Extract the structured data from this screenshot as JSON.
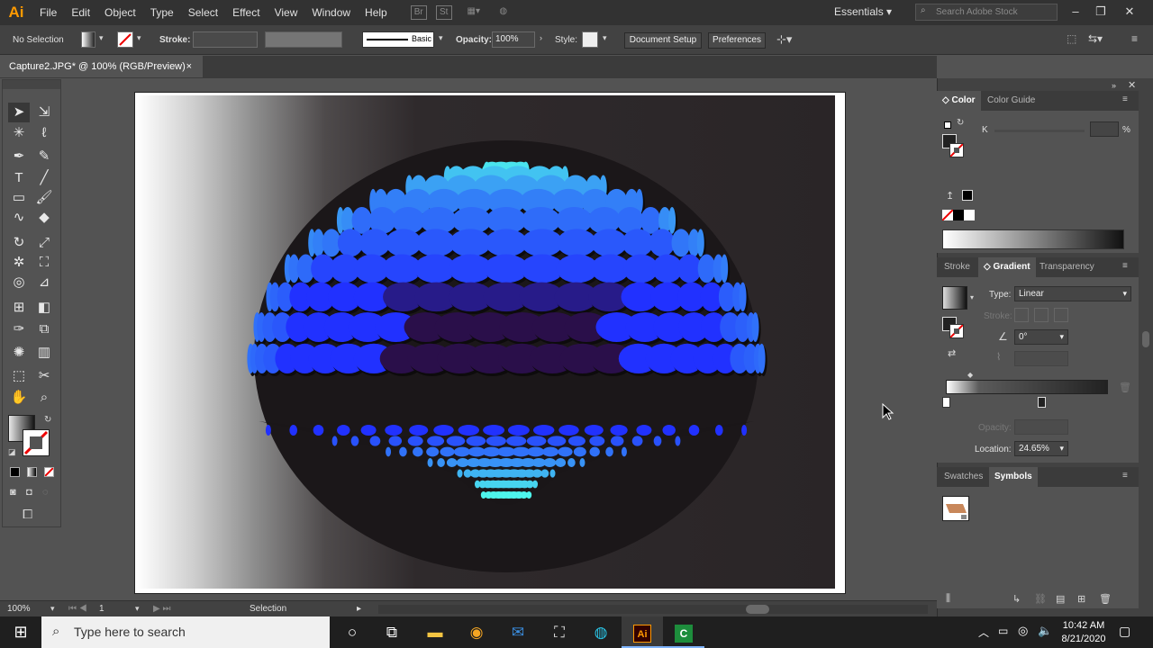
{
  "app": {
    "logo": "Ai"
  },
  "menu": {
    "items": [
      "File",
      "Edit",
      "Object",
      "Type",
      "Select",
      "Effect",
      "View",
      "Window",
      "Help"
    ]
  },
  "header": {
    "workspace": "Essentials",
    "stock_search_placeholder": "Search Adobe Stock"
  },
  "control_bar": {
    "selection": "No Selection",
    "stroke_label": "Stroke:",
    "brush": "Basic",
    "opacity_label": "Opacity:",
    "opacity_value": "100%",
    "style_label": "Style:",
    "document_setup": "Document Setup",
    "preferences": "Preferences"
  },
  "document": {
    "tab_title": "Capture2.JPG* @ 100% (RGB/Preview)",
    "close": "×"
  },
  "status": {
    "zoom": "100%",
    "artboard_number": "1",
    "tool": "Selection"
  },
  "color_panel": {
    "tab_color": "Color",
    "tab_guide": "Color Guide",
    "channel": "K",
    "percent": "%"
  },
  "gradient_panel": {
    "tab_stroke": "Stroke",
    "tab_gradient": "Gradient",
    "tab_transparency": "Transparency",
    "type_label": "Type:",
    "type_value": "Linear",
    "stroke_label": "Stroke:",
    "angle_value": "0°",
    "opacity_label": "Opacity:",
    "location_label": "Location:",
    "location_value": "24.65%"
  },
  "swatches_panel": {
    "tab_swatches": "Swatches",
    "tab_symbols": "Symbols"
  },
  "taskbar": {
    "search_placeholder": "Type here to search",
    "time": "10:42 AM",
    "date": "8/21/2020"
  },
  "colors": {
    "accent": "#ff9a00",
    "dot_cyan": "#4ef5ec",
    "dot_blue": "#2131ff",
    "dot_dark": "#2a0f4a"
  }
}
